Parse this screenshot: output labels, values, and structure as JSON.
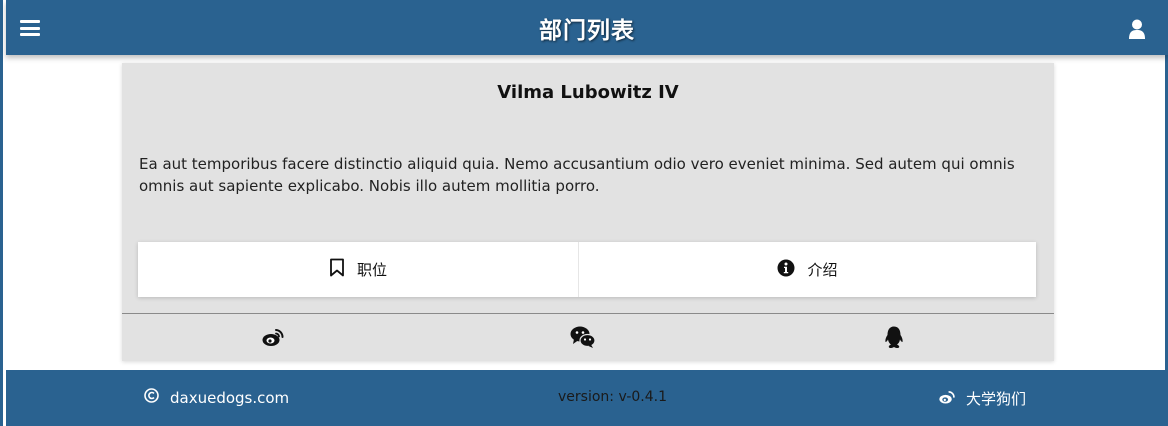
{
  "header": {
    "title": "部门列表",
    "menu_icon": "hamburger-menu-icon",
    "user_icon": "user-icon"
  },
  "card": {
    "name": "Vilma Lubowitz IV",
    "description": "Ea aut temporibus facere distinctio aliquid quia. Nemo accusantium odio vero eveniet minima. Sed autem qui omnis omnis aut sapiente explicabo. Nobis illo autem mollitia porro.",
    "buttons": [
      {
        "label": "职位",
        "icon": "bookmark-icon"
      },
      {
        "label": "介绍",
        "icon": "info-circle-icon"
      }
    ],
    "social": [
      "weibo-icon",
      "wechat-icon",
      "qq-icon"
    ]
  },
  "footer": {
    "site": "daxuedogs.com",
    "version": "version: v-0.4.1",
    "brand": "大学狗们"
  },
  "colors": {
    "header_bg": "#2a6290",
    "card_bg": "#e2e2e2",
    "footer_bg": "#2a6290"
  }
}
